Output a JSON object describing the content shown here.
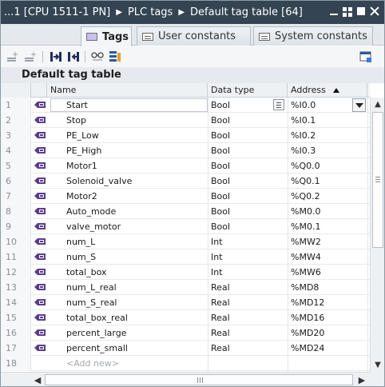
{
  "window": {
    "breadcrumb": [
      "...1 [CPU 1511-1 PN]",
      "PLC tags",
      "Default tag table [64]"
    ],
    "separator": "▶"
  },
  "tabs": [
    {
      "label": "Tags",
      "icon": "tag-icon",
      "active": true
    },
    {
      "label": "User constants",
      "icon": "table-icon",
      "active": false
    },
    {
      "label": "System constants",
      "icon": "table-icon",
      "active": false
    }
  ],
  "toolbar": {
    "icons": [
      "insert-row-icon",
      "add-row-icon",
      "export-icon",
      "import-icon",
      "monitor-glasses-icon",
      "monitor-tags-icon",
      "view-options-icon"
    ]
  },
  "section_title": "Default tag table",
  "columns": {
    "name": "Name",
    "data_type": "Data type",
    "address": "Address"
  },
  "rows": [
    {
      "num": "1",
      "name": "Start",
      "type": "Bool",
      "address": "%I0.0"
    },
    {
      "num": "2",
      "name": "Stop",
      "type": "Bool",
      "address": "%I0.1"
    },
    {
      "num": "3",
      "name": "PE_Low",
      "type": "Bool",
      "address": "%I0.2"
    },
    {
      "num": "4",
      "name": "PE_High",
      "type": "Bool",
      "address": "%I0.3"
    },
    {
      "num": "5",
      "name": "Motor1",
      "type": "Bool",
      "address": "%Q0.0"
    },
    {
      "num": "6",
      "name": "Solenoid_valve",
      "type": "Bool",
      "address": "%Q0.1"
    },
    {
      "num": "7",
      "name": "Motor2",
      "type": "Bool",
      "address": "%Q0.2"
    },
    {
      "num": "8",
      "name": "Auto_mode",
      "type": "Bool",
      "address": "%M0.0"
    },
    {
      "num": "9",
      "name": "valve_motor",
      "type": "Bool",
      "address": "%M0.1"
    },
    {
      "num": "10",
      "name": "num_L",
      "type": "Int",
      "address": "%MW2"
    },
    {
      "num": "11",
      "name": "num_S",
      "type": "Int",
      "address": "%MW4"
    },
    {
      "num": "12",
      "name": "total_box",
      "type": "Int",
      "address": "%MW6"
    },
    {
      "num": "13",
      "name": "num_L_real",
      "type": "Real",
      "address": "%MD8"
    },
    {
      "num": "14",
      "name": "num_S_real",
      "type": "Real",
      "address": "%MD12"
    },
    {
      "num": "15",
      "name": "total_box_real",
      "type": "Real",
      "address": "%MD16"
    },
    {
      "num": "16",
      "name": "percent_large",
      "type": "Real",
      "address": "%MD20"
    },
    {
      "num": "17",
      "name": "percent_small",
      "type": "Real",
      "address": "%MD24"
    }
  ],
  "add_row": {
    "num": "18",
    "placeholder": "<Add new>"
  },
  "colors": {
    "titlebar": "#344452",
    "tag_icon": "#5a3c8c"
  }
}
